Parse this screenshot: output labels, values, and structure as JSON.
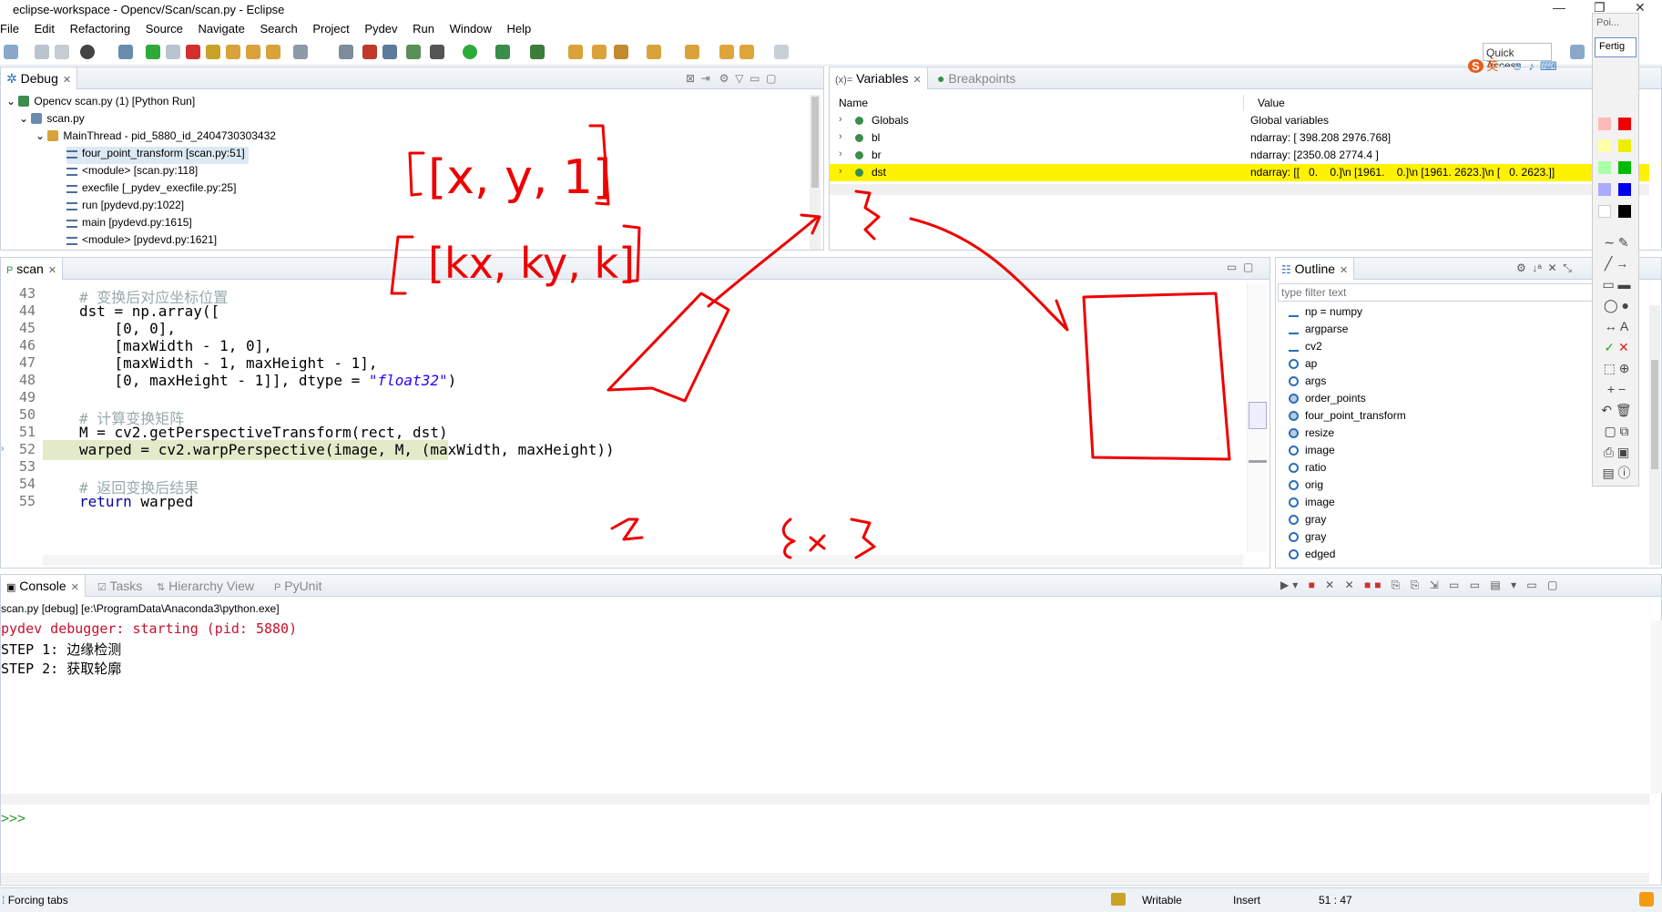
{
  "window": {
    "title": "eclipse-workspace - Opencv/Scan/scan.py - Eclipse"
  },
  "menu": [
    "File",
    "Edit",
    "Refactoring",
    "Source",
    "Navigate",
    "Search",
    "Project",
    "Pydev",
    "Run",
    "Window",
    "Help"
  ],
  "toolbar": {
    "quick_access": "Quick Access"
  },
  "debug": {
    "tab": "Debug",
    "rows": [
      {
        "label": "Opencv scan.py (1) [Python Run]"
      },
      {
        "label": "scan.py"
      },
      {
        "label": "MainThread - pid_5880_id_2404730303432"
      },
      {
        "label": "four_point_transform [scan.py:51]"
      },
      {
        "label": "<module> [scan.py:118]"
      },
      {
        "label": "execfile [_pydev_execfile.py:25]"
      },
      {
        "label": "run [pydevd.py:1022]"
      },
      {
        "label": "main [pydevd.py:1615]"
      },
      {
        "label": "<module> [pydevd.py:1621]"
      }
    ]
  },
  "variables": {
    "tab": "Variables",
    "tab2": "Breakpoints",
    "col_name": "Name",
    "col_value": "Value",
    "rows": [
      {
        "name": "Globals",
        "value": "Global variables"
      },
      {
        "name": "bl",
        "value": "ndarray: [ 398.208 2976.768]"
      },
      {
        "name": "br",
        "value": "ndarray: [2350.08 2774.4 ]"
      },
      {
        "name": "dst",
        "value": "ndarray: [[   0.    0.]\\n [1961.    0.]\\n [1961. 2623.]\\n [   0. 2623.]]"
      }
    ]
  },
  "editor": {
    "tab": "scan",
    "lines": [
      {
        "n": "43",
        "html": "<span class=\"cmt\"># 变换后对应坐标位置</span>"
      },
      {
        "n": "44",
        "html": "dst = np.array(["
      },
      {
        "n": "45",
        "html": "    [0, 0],"
      },
      {
        "n": "46",
        "html": "    [maxWidth - 1, 0],"
      },
      {
        "n": "47",
        "html": "    [maxWidth - 1, maxHeight - 1],"
      },
      {
        "n": "48",
        "html": "    [0, maxHeight - 1]], dtype = <span class=\"str\">\"float32\"</span>)"
      },
      {
        "n": "49",
        "html": ""
      },
      {
        "n": "50",
        "html": "<span class=\"cmt\"># 计算变换矩阵</span>"
      },
      {
        "n": "51",
        "html": "M = cv2.getPerspectiveTransform(rect, dst)"
      },
      {
        "n": "52",
        "html": "warped = cv2.warpPerspective(image, M, (maxWidth, maxHeight))"
      },
      {
        "n": "53",
        "html": ""
      },
      {
        "n": "54",
        "html": "<span class=\"cmt\"># 返回变换后结果</span>"
      },
      {
        "n": "55",
        "html": "<span class=\"kw\">return</span> warped"
      }
    ]
  },
  "outline": {
    "tab": "Outline",
    "filter_placeholder": "type filter text",
    "items": [
      {
        "label": "np = numpy",
        "kind": "import"
      },
      {
        "label": "argparse",
        "kind": "import"
      },
      {
        "label": "cv2",
        "kind": "import"
      },
      {
        "label": "ap",
        "kind": "var"
      },
      {
        "label": "args",
        "kind": "var"
      },
      {
        "label": "order_points",
        "kind": "func"
      },
      {
        "label": "four_point_transform",
        "kind": "func"
      },
      {
        "label": "resize",
        "kind": "func"
      },
      {
        "label": "image",
        "kind": "var"
      },
      {
        "label": "ratio",
        "kind": "var"
      },
      {
        "label": "orig",
        "kind": "var"
      },
      {
        "label": "image",
        "kind": "var"
      },
      {
        "label": "gray",
        "kind": "var"
      },
      {
        "label": "gray",
        "kind": "var"
      },
      {
        "label": "edged",
        "kind": "var"
      }
    ]
  },
  "console": {
    "tabs": [
      "Console",
      "Tasks",
      "Hierarchy View",
      "PyUnit"
    ],
    "header": "scan.py [debug] [e:\\ProgramData\\Anaconda3\\python.exe]",
    "lines": [
      {
        "text": "pydev debugger: starting (pid: 5880)",
        "color": "#c8102e"
      },
      {
        "text": "STEP 1: 边缘检测",
        "color": "#000"
      },
      {
        "text": "STEP 2: 获取轮廓",
        "color": "#000"
      }
    ],
    "prompt": ">>>"
  },
  "status": {
    "left": "Forcing tabs",
    "writable": "Writable",
    "insert": "Insert",
    "position": "51 : 47"
  },
  "palette": {
    "title": "Poi...",
    "done": "Fertig"
  },
  "ime": {
    "label": "英"
  },
  "annotations": {
    "label1": "[x, y, 1]",
    "label2": "[kx, ky, k]",
    "label3": "2",
    "label4": "3x3"
  }
}
